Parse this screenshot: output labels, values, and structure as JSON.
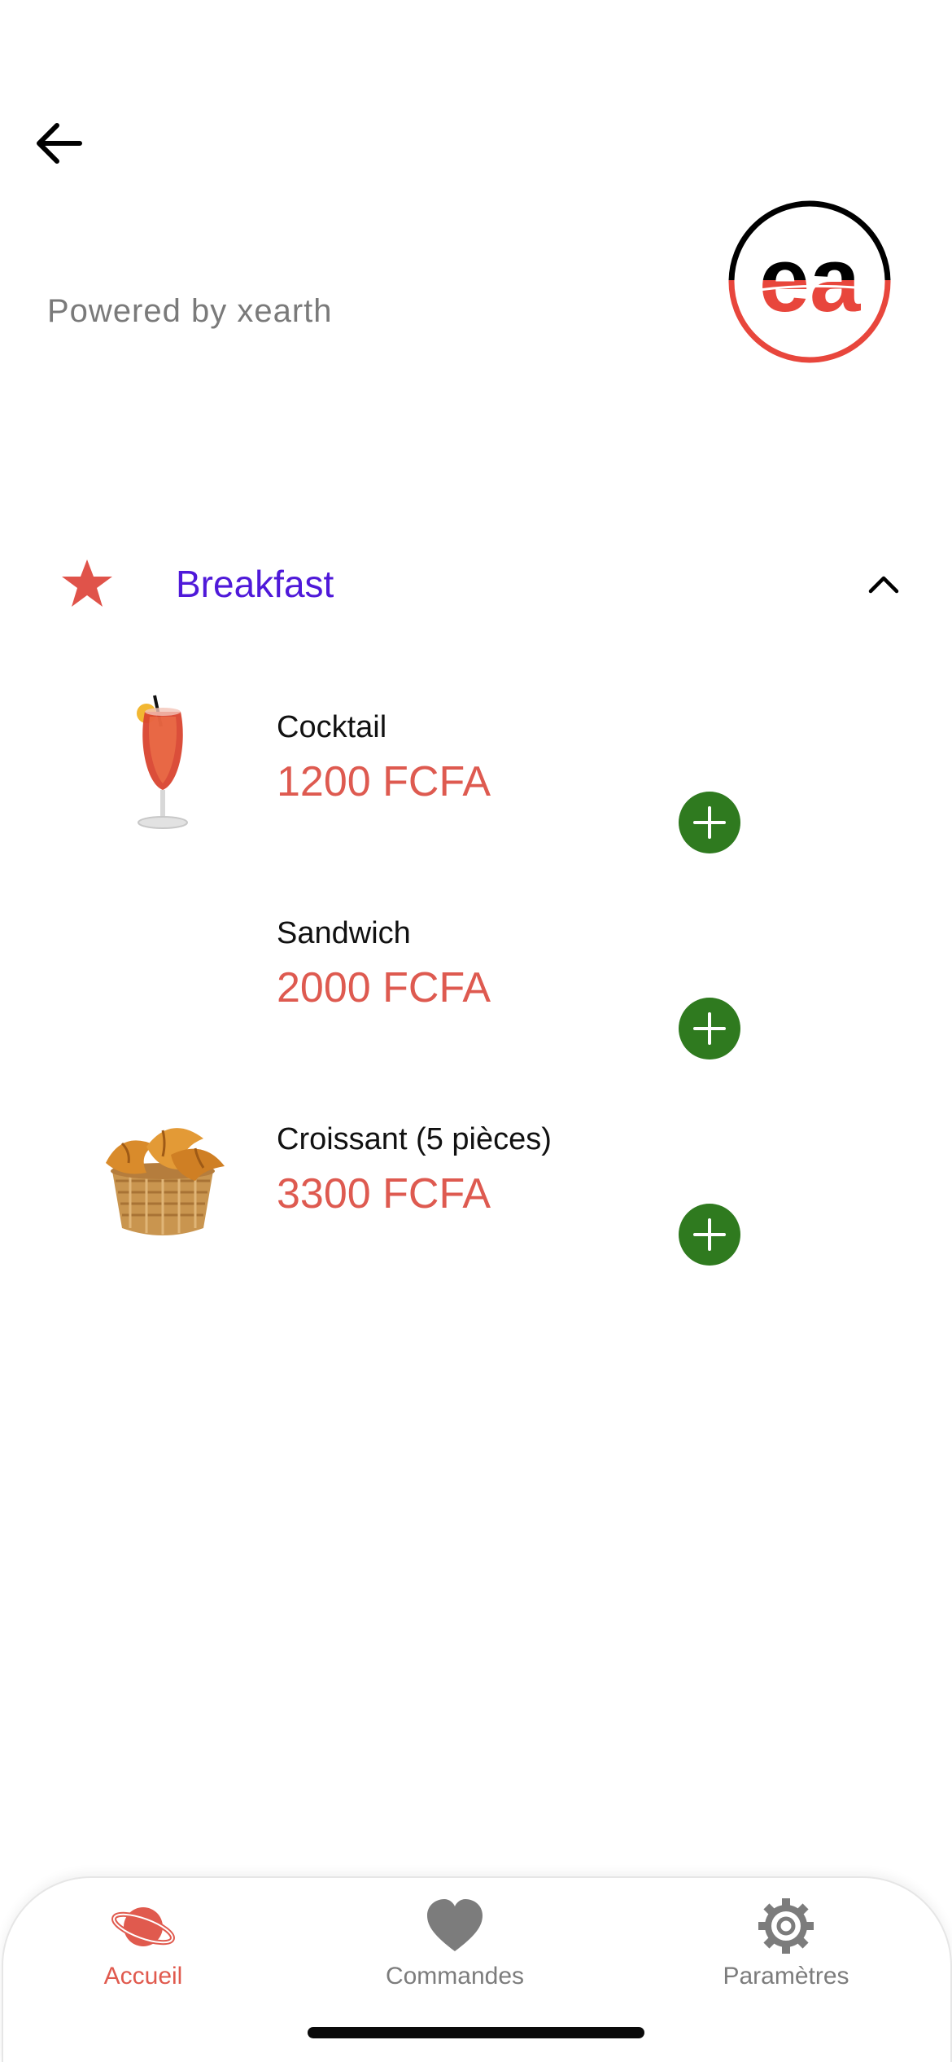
{
  "header": {
    "back_icon": "arrow-left-icon",
    "powered_by": "Powered by xearth",
    "logo_text": "ea",
    "logo_colors": {
      "top": "#000000",
      "bottom": "#e8463c"
    }
  },
  "category": {
    "icon": "star-icon",
    "title": "Breakfast",
    "title_color": "#4f19d9",
    "expanded": true
  },
  "items": [
    {
      "name": "Cocktail",
      "price": "1200 FCFA",
      "image": "cocktail-image"
    },
    {
      "name": "Sandwich",
      "price": "2000 FCFA",
      "image": null
    },
    {
      "name": "Croissant (5 pièces)",
      "price": "3300 FCFA",
      "image": "croissant-basket-image"
    }
  ],
  "colors": {
    "price": "#de5a50",
    "add_button": "#2f7a1f",
    "active_tab": "#e05a4e",
    "inactive_tab": "#7c7c7c"
  },
  "tabbar": {
    "tabs": [
      {
        "label": "Accueil",
        "icon": "planet-icon",
        "active": true
      },
      {
        "label": "Commandes",
        "icon": "heart-icon",
        "active": false
      },
      {
        "label": "Paramètres",
        "icon": "gear-icon",
        "active": false
      }
    ]
  }
}
